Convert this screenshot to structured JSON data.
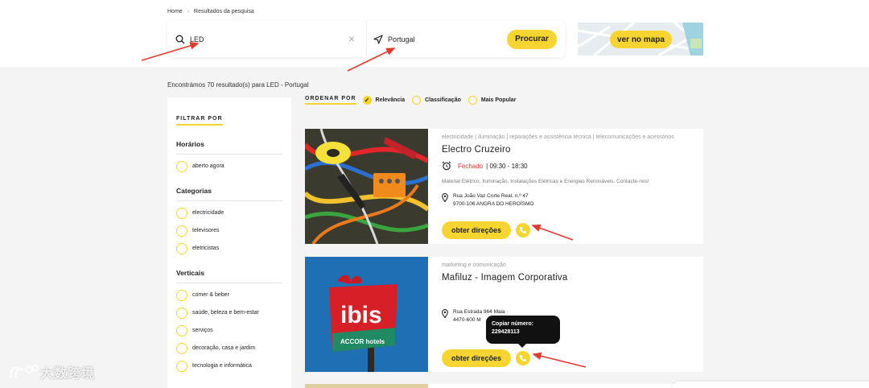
{
  "breadcrumb": {
    "home": "Home",
    "separator": "›",
    "current": "Resultados da pesquisa"
  },
  "search": {
    "query": "LED",
    "location": "Portugal",
    "submit_label": "Procurar"
  },
  "map": {
    "button_label": "ver no mapa"
  },
  "results_summary": "Encontrámos 70 resultado(s) para LED - Portugal",
  "filters": {
    "title": "FILTRAR POR",
    "sections": [
      {
        "title": "Horários",
        "options": [
          "aberto agora"
        ]
      },
      {
        "title": "Categorias",
        "options": [
          "electricidade",
          "televisores",
          "eletricistas"
        ]
      },
      {
        "title": "Verticais",
        "options": [
          "comer & beber",
          "saúde, beleza e bem-estar",
          "serviços",
          "decoração, casa e jardim",
          "tecnologia e informática"
        ]
      }
    ]
  },
  "ordering": {
    "label": "ORDENAR POR",
    "options": [
      {
        "label": "Relevância",
        "selected": true
      },
      {
        "label": "Classificação",
        "selected": false
      },
      {
        "label": "Mais Popular",
        "selected": false
      }
    ]
  },
  "results": [
    {
      "categories": "electricidade | iluminação | reparações e assistência técnica | telecomunicações e acessórios",
      "name": "Electro Cruzeiro",
      "status": "Fechado",
      "hours": "| 09:30 - 18:30",
      "description": "Material Elétrico, Iluminação, Instalações Elétricas e Energias Renováveis. Contacte-nos!",
      "address_line1": "Rua João Vaz Corte Real, n.º 47",
      "address_line2": "9700-106 ANGRA DO HEROÍSMO",
      "directions_label": "obter direções"
    },
    {
      "categories": "marketing e comunicação",
      "name": "Mafiluz - Imagem Corporativa",
      "address_line1": "Rua Estrada 964 Maia",
      "address_line2": "4470-600 M",
      "directions_label": "obter direções",
      "sign_text": "ibis",
      "sign_sub": "ACCOR hotels"
    }
  ],
  "tooltip": {
    "title": "Copiar número:",
    "number": "229428113"
  },
  "watermark": "大数跨境",
  "colors": {
    "accent": "#f7d530",
    "closed": "#d9342b",
    "arrow": "#e23b2e"
  }
}
